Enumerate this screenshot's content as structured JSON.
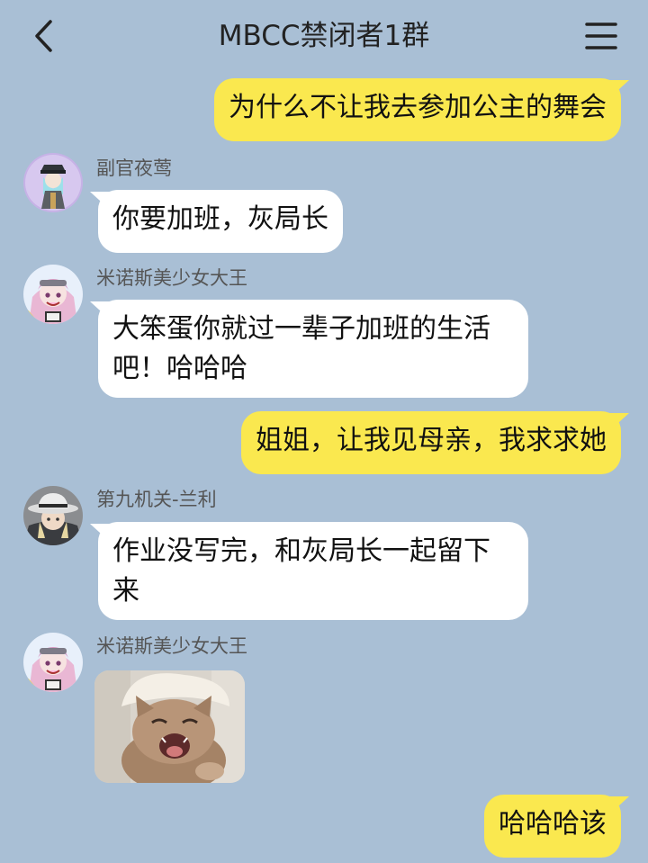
{
  "header": {
    "title": "MBCC禁闭者1群",
    "back_icon": "chevron-left-icon",
    "menu_icon": "hamburger-menu-icon"
  },
  "colors": {
    "background": "#a9bfd5",
    "incoming_bubble": "#ffffff",
    "outgoing_bubble": "#fae84f"
  },
  "messages": [
    {
      "direction": "out",
      "text": "为什么不让我去参加公主的舞会"
    },
    {
      "direction": "in",
      "sender": "副官夜莺",
      "avatar": "avatar-officer",
      "text": "你要加班，灰局长"
    },
    {
      "direction": "in",
      "sender": "米诺斯美少女大王",
      "avatar": "avatar-pink-girl",
      "text": "大笨蛋你就过一辈子加班的生活吧！哈哈哈"
    },
    {
      "direction": "out",
      "text": "姐姐，让我见母亲，我求求她"
    },
    {
      "direction": "in",
      "sender": "第九机关-兰利",
      "avatar": "avatar-hat-man",
      "text": "作业没写完，和灰局长一起留下来"
    },
    {
      "direction": "in",
      "sender": "米诺斯美少女大王",
      "avatar": "avatar-pink-girl",
      "image": "crying-cat-sticker"
    },
    {
      "direction": "out",
      "text": "哈哈哈该"
    }
  ]
}
